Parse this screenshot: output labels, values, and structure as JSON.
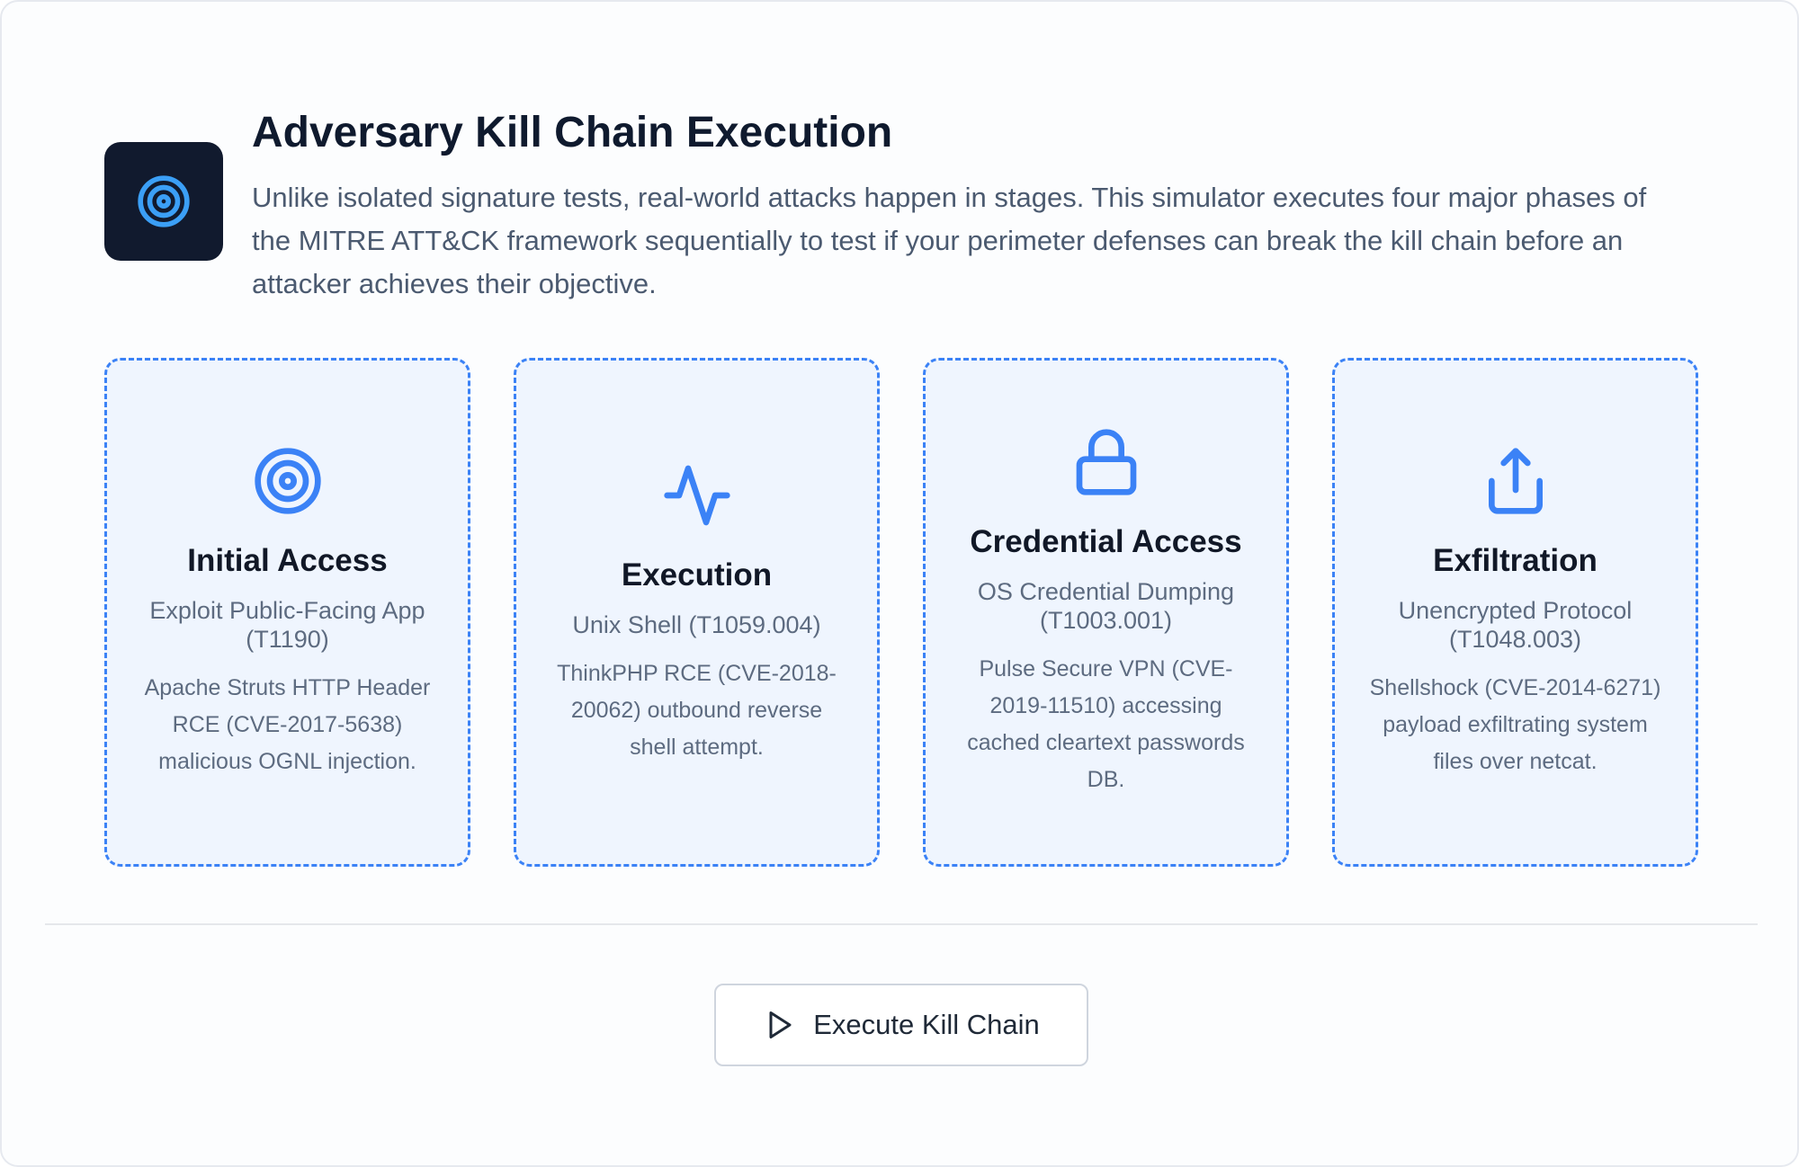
{
  "header": {
    "title": "Adversary Kill Chain Execution",
    "description": "Unlike isolated signature tests, real-world attacks happen in stages. This simulator executes four major phases of the MITRE ATT&CK framework sequentially to test if your perimeter defenses can break the kill chain before an attacker achieves their objective.",
    "icon": "target-icon"
  },
  "stages": [
    {
      "icon": "target-icon",
      "title": "Initial Access",
      "technique": "Exploit Public-Facing App (T1190)",
      "detail": "Apache Struts HTTP Header RCE (CVE-2017-5638) malicious OGNL injection."
    },
    {
      "icon": "activity-pulse-icon",
      "title": "Execution",
      "technique": "Unix Shell (T1059.004)",
      "detail": "ThinkPHP RCE (CVE-2018-20062) outbound reverse shell attempt."
    },
    {
      "icon": "lock-icon",
      "title": "Credential Access",
      "technique": "OS Credential Dumping (T1003.001)",
      "detail": "Pulse Secure VPN (CVE-2019-11510) accessing cached cleartext passwords DB."
    },
    {
      "icon": "upload-icon",
      "title": "Exfiltration",
      "technique": "Unencrypted Protocol (T1048.003)",
      "detail": "Shellshock (CVE-2014-6271) payload exfiltrating system files over netcat."
    }
  ],
  "actions": {
    "execute_label": "Execute Kill Chain",
    "execute_icon": "play-icon"
  },
  "colors": {
    "accent": "#3b82f6",
    "card_background": "#eff5fe",
    "brand_tile": "#111a2e",
    "title_text": "#0f1a2e",
    "muted_text": "#5d6b80"
  }
}
